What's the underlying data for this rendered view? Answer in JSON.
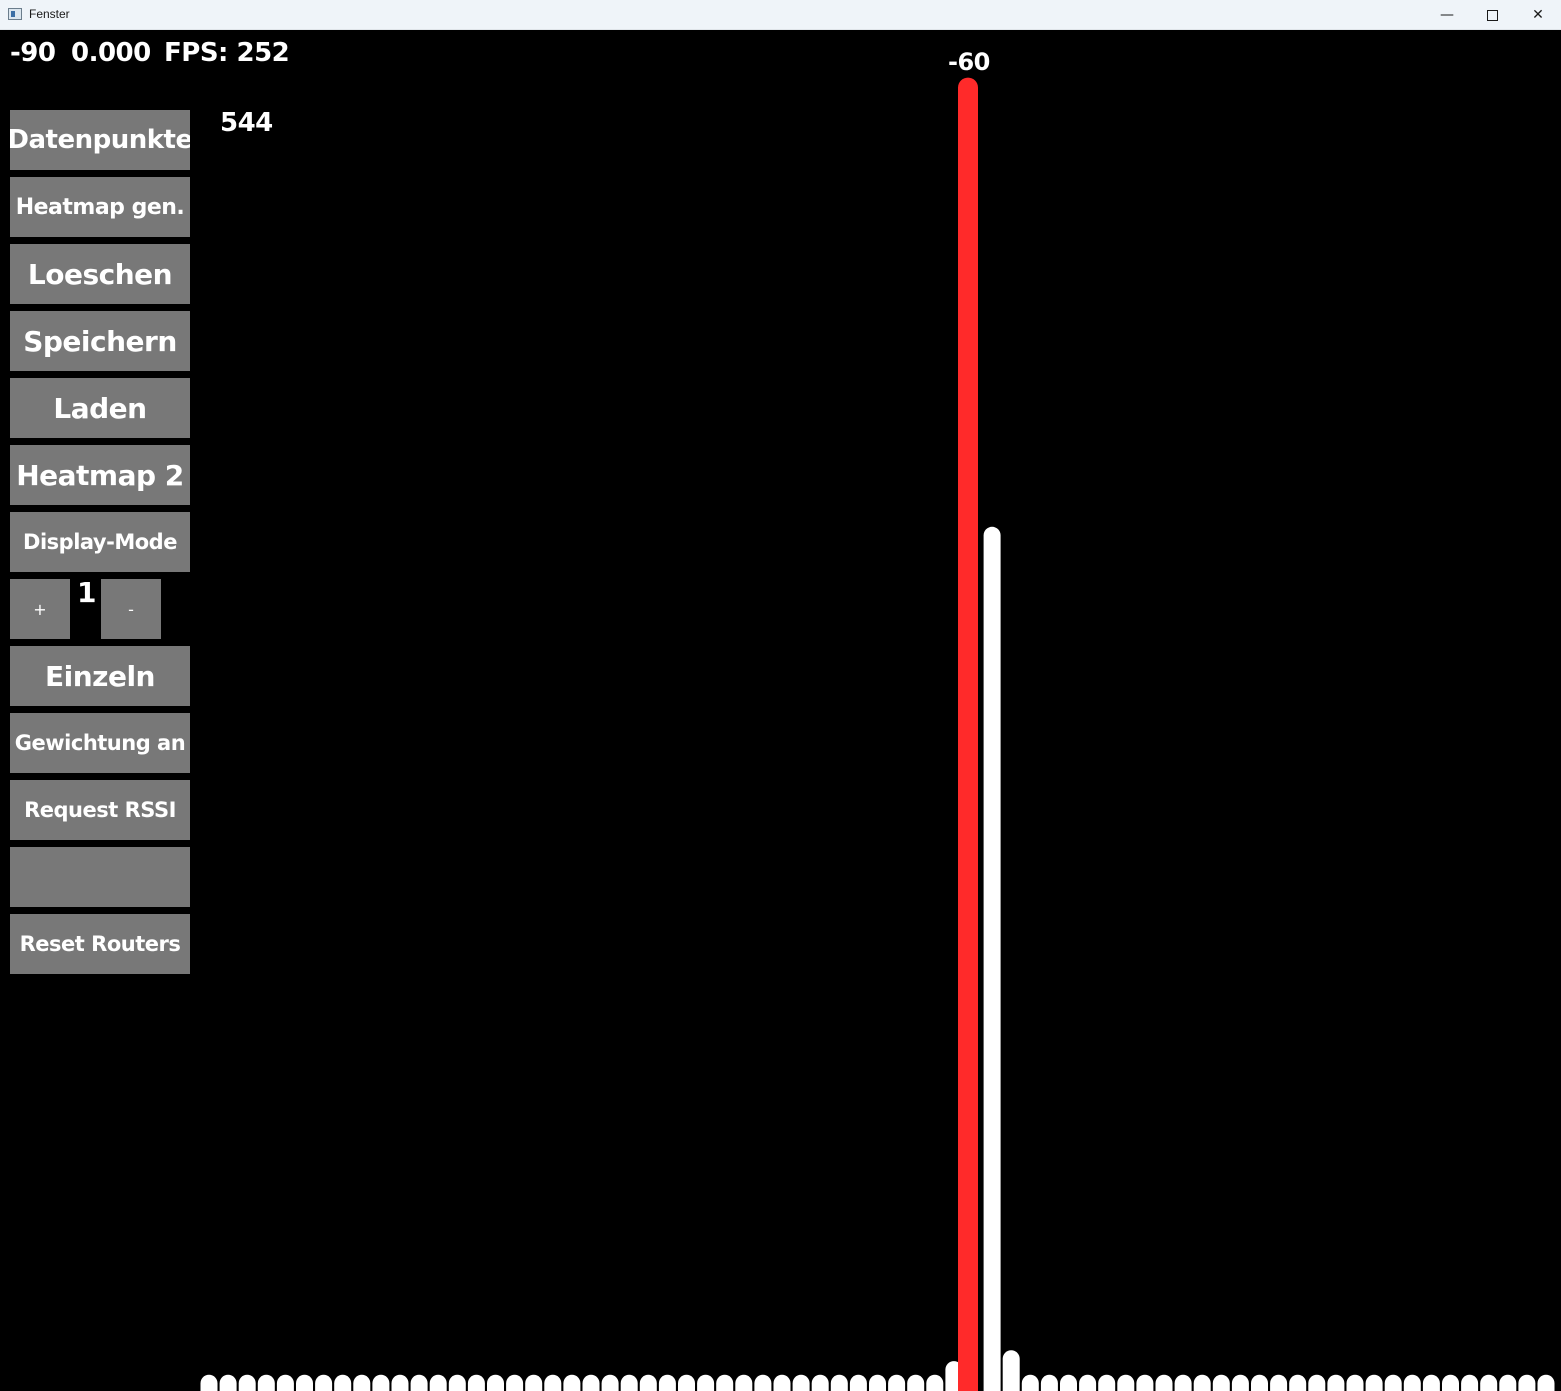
{
  "window": {
    "title": "Fenster",
    "controls": {
      "minimize": "—",
      "maximize": "",
      "close": "✕"
    }
  },
  "stats": {
    "left_value": "-90",
    "middle_value": "0.000",
    "fps_text": "FPS: 252"
  },
  "count_value": "544",
  "peak_label": "-60",
  "sidebar": {
    "buttons": [
      {
        "label": "Datenpunkte"
      },
      {
        "label": "Heatmap gen."
      },
      {
        "label": "Loeschen"
      },
      {
        "label": "Speichern"
      },
      {
        "label": "Laden"
      },
      {
        "label": "Heatmap 2"
      },
      {
        "label": "Display-Mode"
      },
      {
        "label": "Einzeln"
      },
      {
        "label": "Gewichtung an"
      },
      {
        "label": "Request RSSI"
      },
      {
        "label": ""
      },
      {
        "label": "Reset Routers"
      }
    ],
    "stepper": {
      "plus_label": "+",
      "value": "1",
      "minus_label": "-"
    }
  },
  "colors": {
    "background": "#000000",
    "button": "#787878",
    "highlight_bar": "#ff2a2a",
    "bar": "#ffffff"
  },
  "chart_data": {
    "type": "bar",
    "highlight": {
      "label": "-60",
      "level": 0.965
    },
    "bars": [
      0.012,
      0.012,
      0.012,
      0.012,
      0.012,
      0.012,
      0.012,
      0.012,
      0.012,
      0.012,
      0.012,
      0.012,
      0.012,
      0.012,
      0.012,
      0.012,
      0.012,
      0.012,
      0.012,
      0.012,
      0.012,
      0.012,
      0.012,
      0.012,
      0.012,
      0.012,
      0.012,
      0.012,
      0.012,
      0.012,
      0.012,
      0.012,
      0.012,
      0.012,
      0.012,
      0.012,
      0.012,
      0.012,
      0.012,
      0.022,
      0.0,
      0.635,
      0.03,
      0.012,
      0.012,
      0.012,
      0.012,
      0.012,
      0.012,
      0.012,
      0.012,
      0.012,
      0.012,
      0.012,
      0.012,
      0.012,
      0.012,
      0.012,
      0.012,
      0.012,
      0.012,
      0.012,
      0.012,
      0.012,
      0.012,
      0.012,
      0.012,
      0.012,
      0.012,
      0.012,
      0.012
    ]
  }
}
